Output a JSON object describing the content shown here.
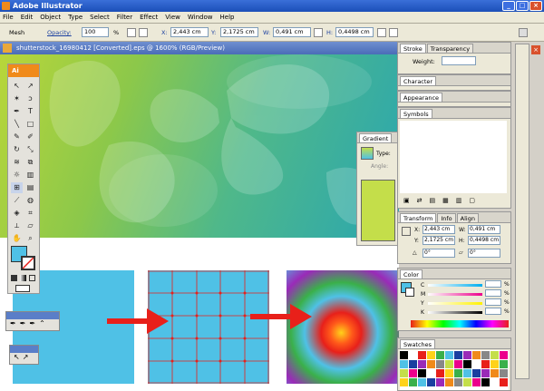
{
  "app": {
    "title": "Adobe Illustrator",
    "logo": "Ai"
  },
  "menu": [
    "File",
    "Edit",
    "Object",
    "Type",
    "Select",
    "Filter",
    "Effect",
    "View",
    "Window",
    "Help"
  ],
  "control": {
    "mode": "Mesh",
    "opacity_label": "Opacity:",
    "opacity_value": "100",
    "opacity_unit": "%",
    "x_label": "X:",
    "x_value": "2,443 cm",
    "y_label": "Y:",
    "y_value": "2,1725 cm",
    "w_label": "W:",
    "w_value": "0,491 cm",
    "h_label": "H:",
    "h_value": "0,4498 cm"
  },
  "document": {
    "tab_title": "shutterstock_16980412 [Converted].eps @ 1600% (RGB/Preview)"
  },
  "gradient_panel": {
    "tab": "Gradient",
    "type_label": "Type:",
    "angle_label": "Angle:",
    "swatch_color": "#c4de4a"
  },
  "panels": {
    "stroke": {
      "tab": "Stroke",
      "tab2": "Transparency",
      "weight_label": "Weight:"
    },
    "character": {
      "tab": "Character"
    },
    "appearance": {
      "tab": "Appearance"
    },
    "symbols": {
      "tab": "Symbols"
    },
    "transform": {
      "tabs": [
        "Transform",
        "Info",
        "Align"
      ],
      "x": "2,443 cm",
      "y": "2,1725 cm",
      "w": "0,491 cm",
      "h": "0,4498 cm",
      "x_label": "X:",
      "y_label": "Y:",
      "w_label": "W:",
      "h_label": "H:",
      "rot": "0°",
      "shear": "0°"
    },
    "color": {
      "tab": "Color",
      "channels": [
        "C",
        "M",
        "Y",
        "K"
      ],
      "unit": "%"
    },
    "swatches": {
      "tab": "Swatches"
    }
  },
  "colors": {
    "accent": "#f08a1a",
    "cyan": "#4fc1e6",
    "arrow": "#e8201a",
    "titlebar": "#2a5fc8"
  }
}
